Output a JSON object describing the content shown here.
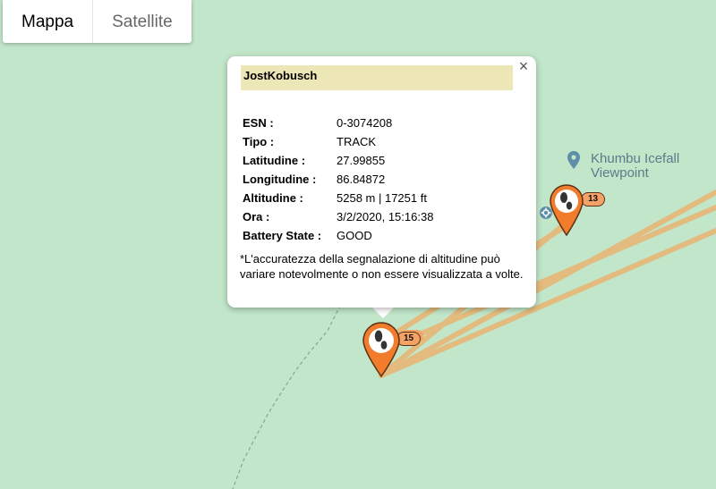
{
  "map_type": {
    "map_label": "Mappa",
    "satellite_label": "Satellite"
  },
  "poi": {
    "name": "Khumbu Icefall\nViewpoint"
  },
  "popup": {
    "title": "JostKobusch",
    "rows": [
      {
        "label": "ESN :",
        "value": "0-3074208"
      },
      {
        "label": "Tipo :",
        "value": "TRACK"
      },
      {
        "label": "Latitudine :",
        "value": "27.99855"
      },
      {
        "label": "Longitudine :",
        "value": "86.84872"
      },
      {
        "label": "Altitudine :",
        "value": "5258 m | 17251 ft"
      },
      {
        "label": "Ora :",
        "value": "3/2/2020, 15:16:38"
      },
      {
        "label": "Battery State :",
        "value": "GOOD"
      }
    ],
    "note": "*L'accuratezza della segnalazione di altitudine può variare notevolmente o non essere visualizzata a volte.",
    "close_symbol": "×"
  },
  "markers": [
    {
      "count": "15",
      "icon": "footprint-icon"
    },
    {
      "count": "13",
      "icon": "footprint-icon"
    }
  ],
  "colors": {
    "map_bg": "#c2e6c9",
    "track": "#e6b97a",
    "marker": "#f07c2c",
    "popup_title_bg": "#ede6b6"
  }
}
